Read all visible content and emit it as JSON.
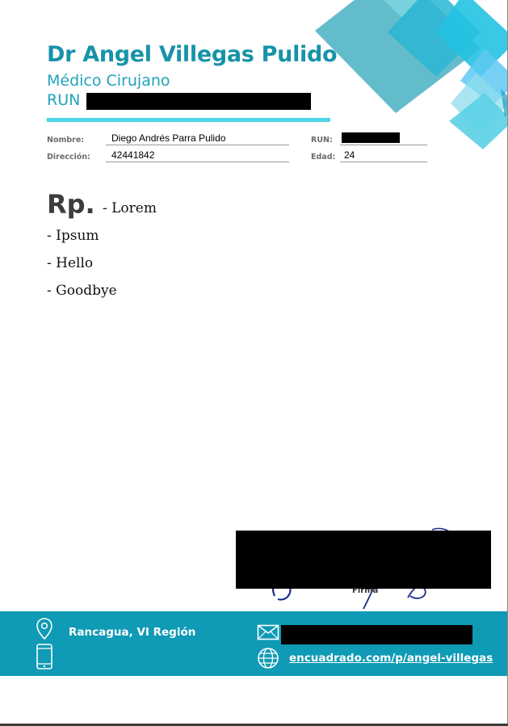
{
  "header": {
    "doctor_name": "Dr Angel Villegas Pulido",
    "specialty": "Médico Cirujano",
    "run_label": "RUN"
  },
  "patient": {
    "name_label": "Nombre:",
    "name_value": "Diego Andrés Parra Pulido",
    "address_label": "Dirección:",
    "address_value": "42441842",
    "run_label": "RUN:",
    "age_label": "Edad:",
    "age_value": "24"
  },
  "prescription": {
    "heading": "Rp.",
    "items": [
      "- Lorem",
      "- Ipsum",
      "- Hello",
      "- Goodbye"
    ]
  },
  "signature": {
    "label": "Firma"
  },
  "footer": {
    "location": "Rancagua, VI Región",
    "website": "encuadrado.com/p/angel-villegas",
    "icons": [
      "map-pin-icon",
      "mobile-phone-icon",
      "envelope-icon",
      "globe-icon"
    ]
  },
  "colors": {
    "brand_dark": "#1793a9",
    "brand_light": "#4dd5e5",
    "footer_bg": "#0f9ab5",
    "redaction": "#000000"
  }
}
